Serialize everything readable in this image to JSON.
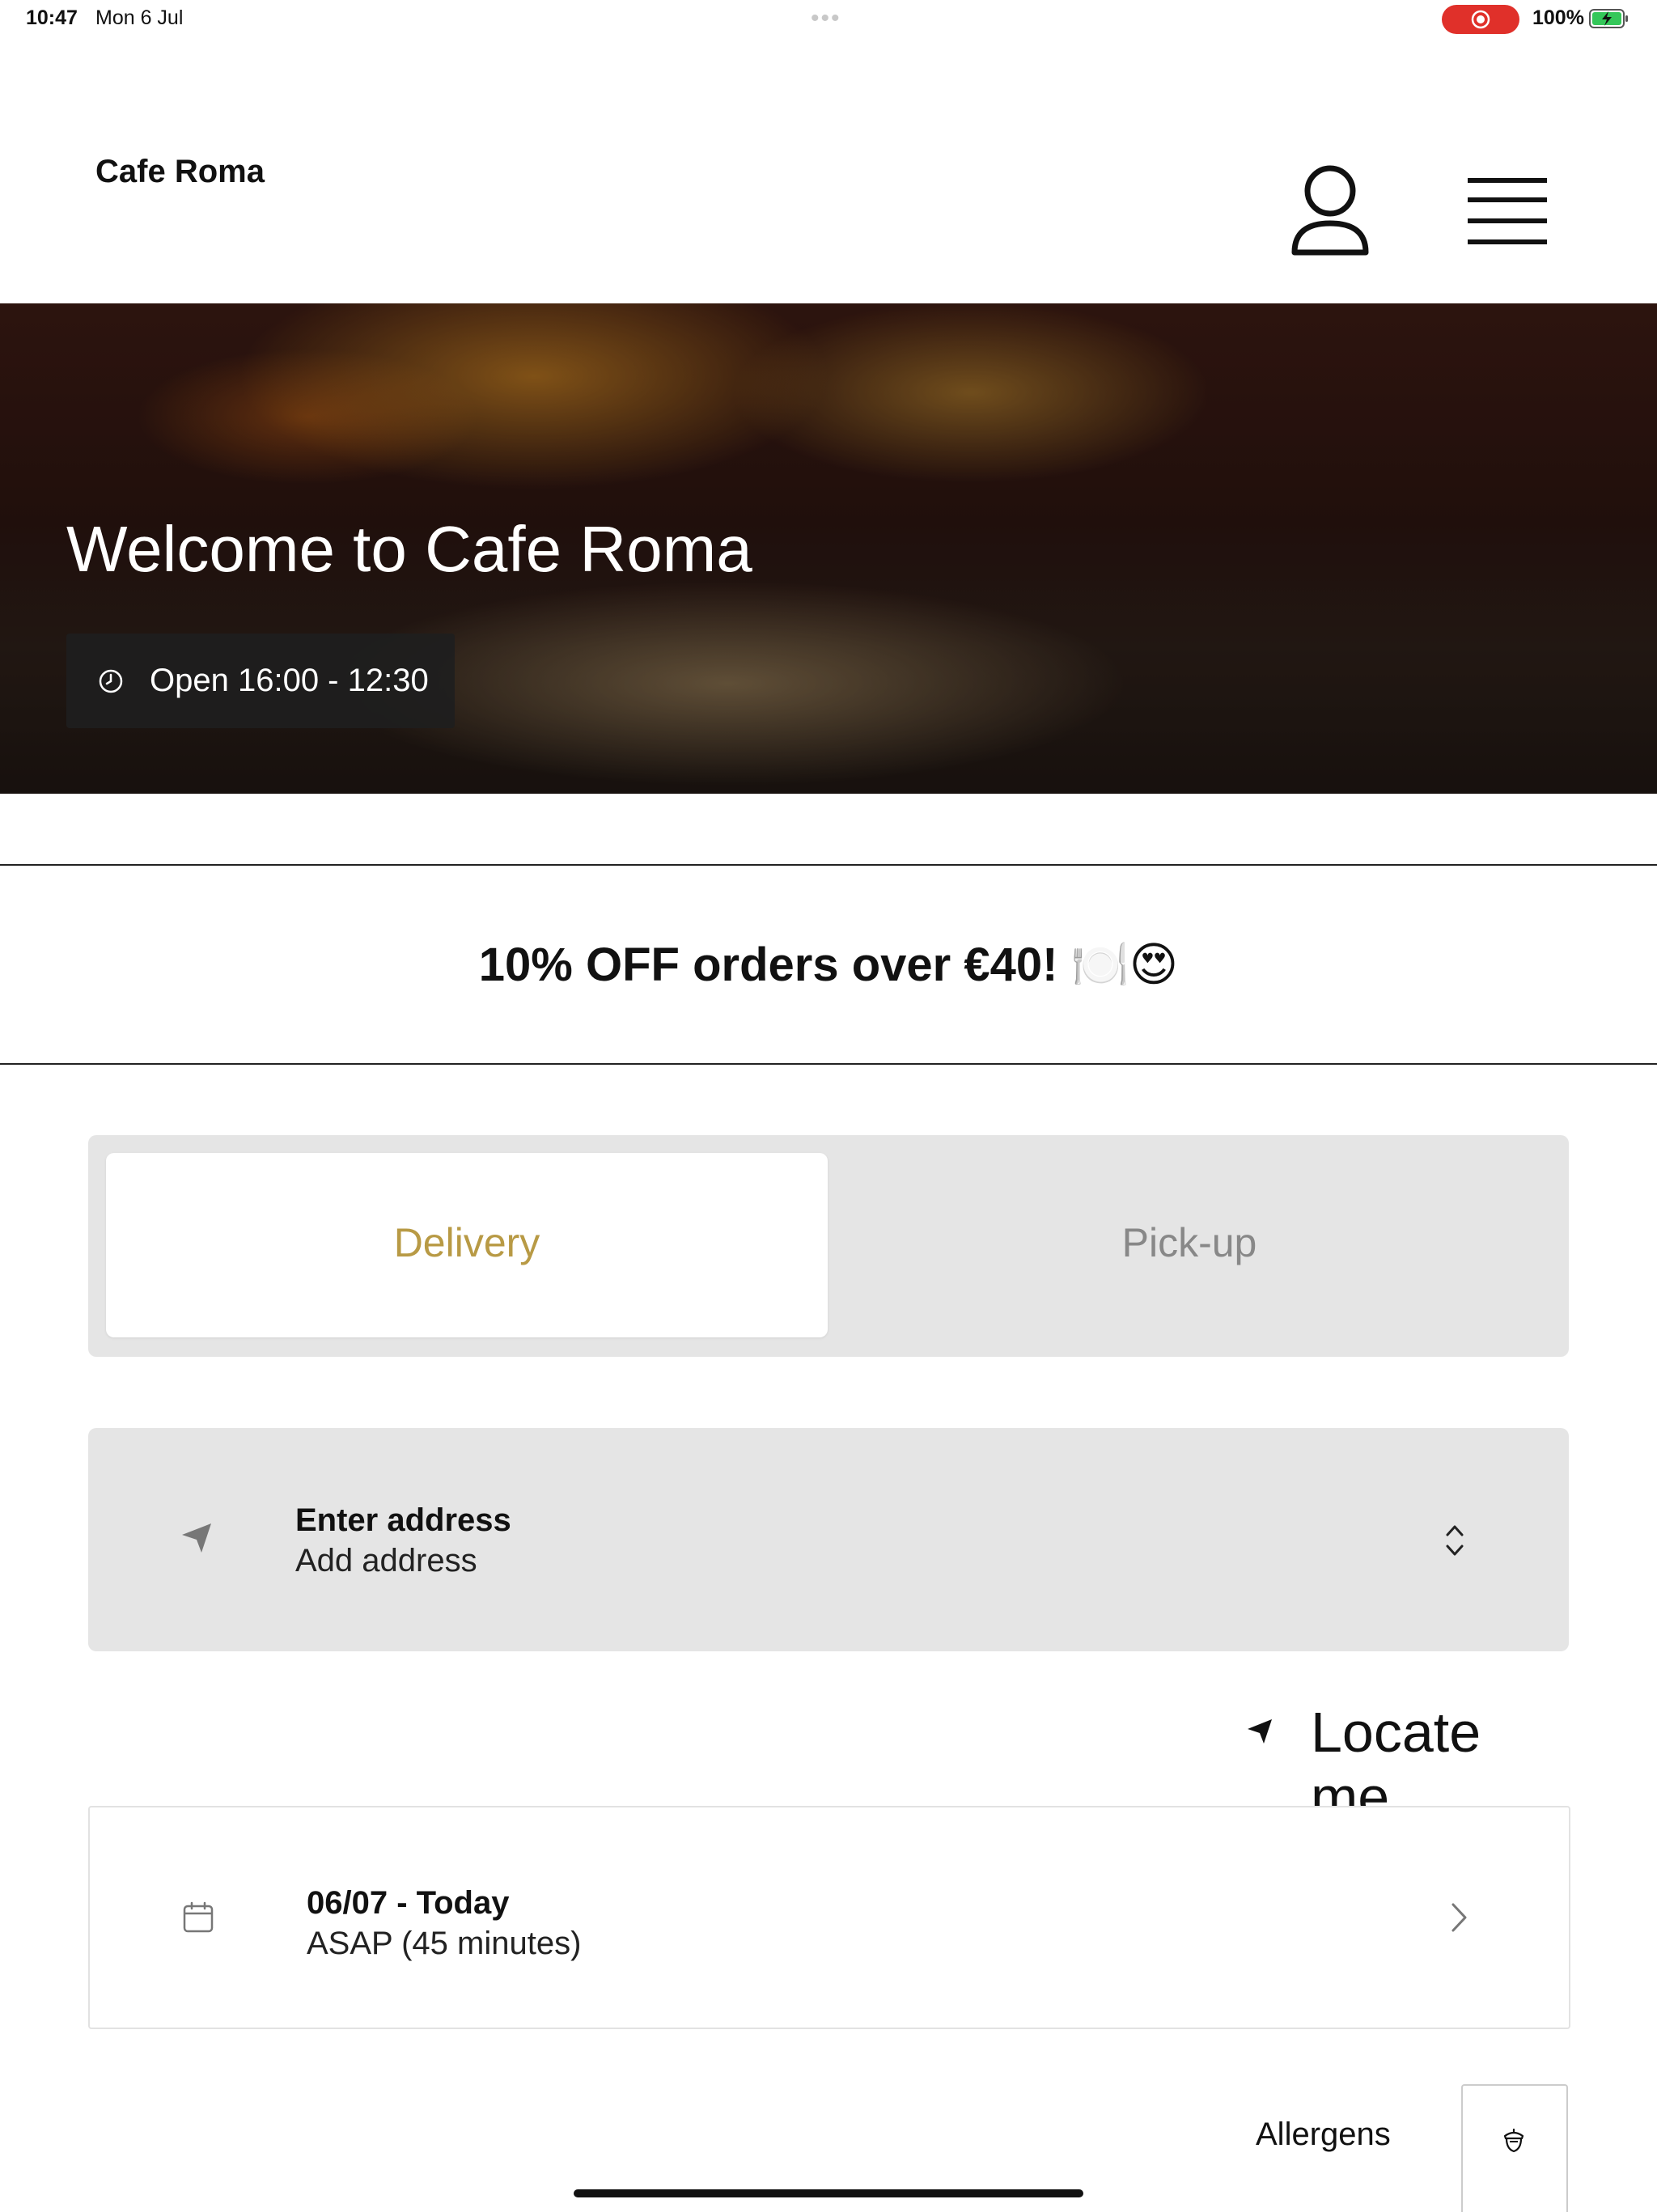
{
  "status_bar": {
    "time": "10:47",
    "date": "Mon 6 Jul",
    "battery_percent": "100%",
    "recording_color": "#e0302a"
  },
  "header": {
    "brand": "Cafe Roma",
    "account_icon": "person-icon",
    "menu_icon": "hamburger-menu-icon"
  },
  "hero": {
    "title": "Welcome to Cafe Roma",
    "hours": "Open 16:00 - 12:30",
    "hours_icon": "clock-icon"
  },
  "promo": {
    "text": "10% OFF orders over €40! 🍽️😍"
  },
  "order_type": {
    "options": [
      "Delivery",
      "Pick-up"
    ],
    "selected": "Delivery",
    "accent_color": "#b89a45"
  },
  "address": {
    "label": "Enter address",
    "value": "Add address",
    "icon": "navigation-arrow-icon",
    "chevron": "chevron-up-down-icon"
  },
  "locate": {
    "label": "Locate me",
    "icon": "location-arrow-icon"
  },
  "schedule": {
    "date": "06/07 - Today",
    "time": "ASAP (45 minutes)",
    "icon": "calendar-icon"
  },
  "allergens": {
    "label": "Allergens",
    "icon": "allergen-acorn-icon"
  }
}
